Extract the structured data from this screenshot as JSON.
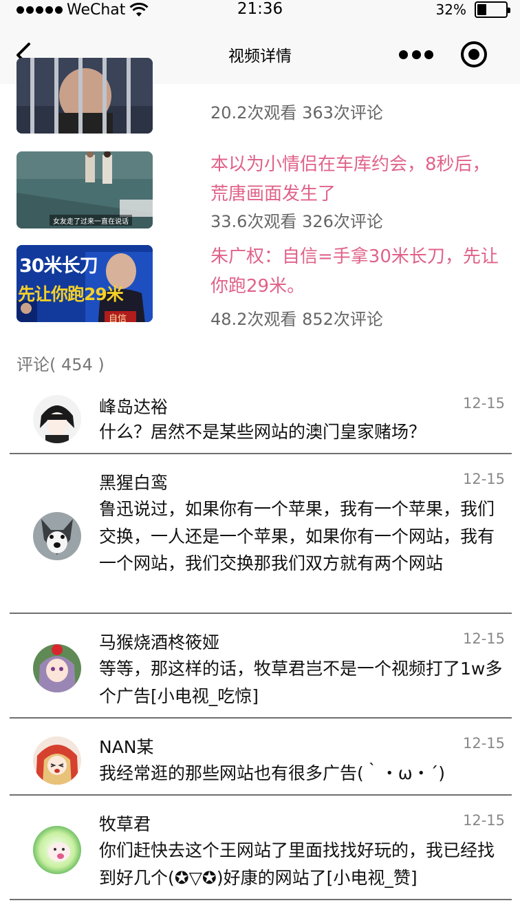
{
  "status_bar": {
    "carrier": "WeChat",
    "time": "21:36",
    "battery": "32%",
    "battery_level": 0.32
  },
  "nav": {
    "title": "视频详情"
  },
  "related_videos": [
    {
      "title": "",
      "meta": "20.2次观看 363次评论"
    },
    {
      "title": "本以为小情侣在车库约会，8秒后，荒唐画面发生了",
      "meta": "33.6次观看 326次评论",
      "thumb_caption": "女友走了过来一直在说话"
    },
    {
      "title": "朱广权：自信=手拿30米长刀，先让你跑29米。",
      "meta": "48.2次观看 852次评论",
      "thumb_text_line1": "30米长刀",
      "thumb_text_line2": "先让你跑29米",
      "thumb_badge": "自信"
    }
  ],
  "comments_header": "评论( 454 )",
  "comments": [
    {
      "name": "峰岛达裕",
      "date": "12-15",
      "text": "什么？居然不是某些网站的澳门皇家赌场？"
    },
    {
      "name": "黑猩白鸾",
      "date": "12-15",
      "text": "鲁迅说过，如果你有一个苹果，我有一个苹果，我们交换，一人还是一个苹果，如果你有一个网站，我有一个网站，我们交换那我们双方就有两个网站"
    },
    {
      "name": "马猴烧酒柊筱娅",
      "date": "12-15",
      "text": "等等，那这样的话，牧草君岂不是一个视频打了1w多个广告[小电视_吃惊]"
    },
    {
      "name": "NAN某",
      "date": "12-15",
      "text": "我经常逛的那些网站也有很多广告(｀・ω・´)"
    },
    {
      "name": "牧草君",
      "date": "12-15",
      "text": "你们赶快去这个王网站了里面找找好玩的，我已经找到好几个(✪▽✪)好康的网站了[小电视_赞]"
    }
  ]
}
